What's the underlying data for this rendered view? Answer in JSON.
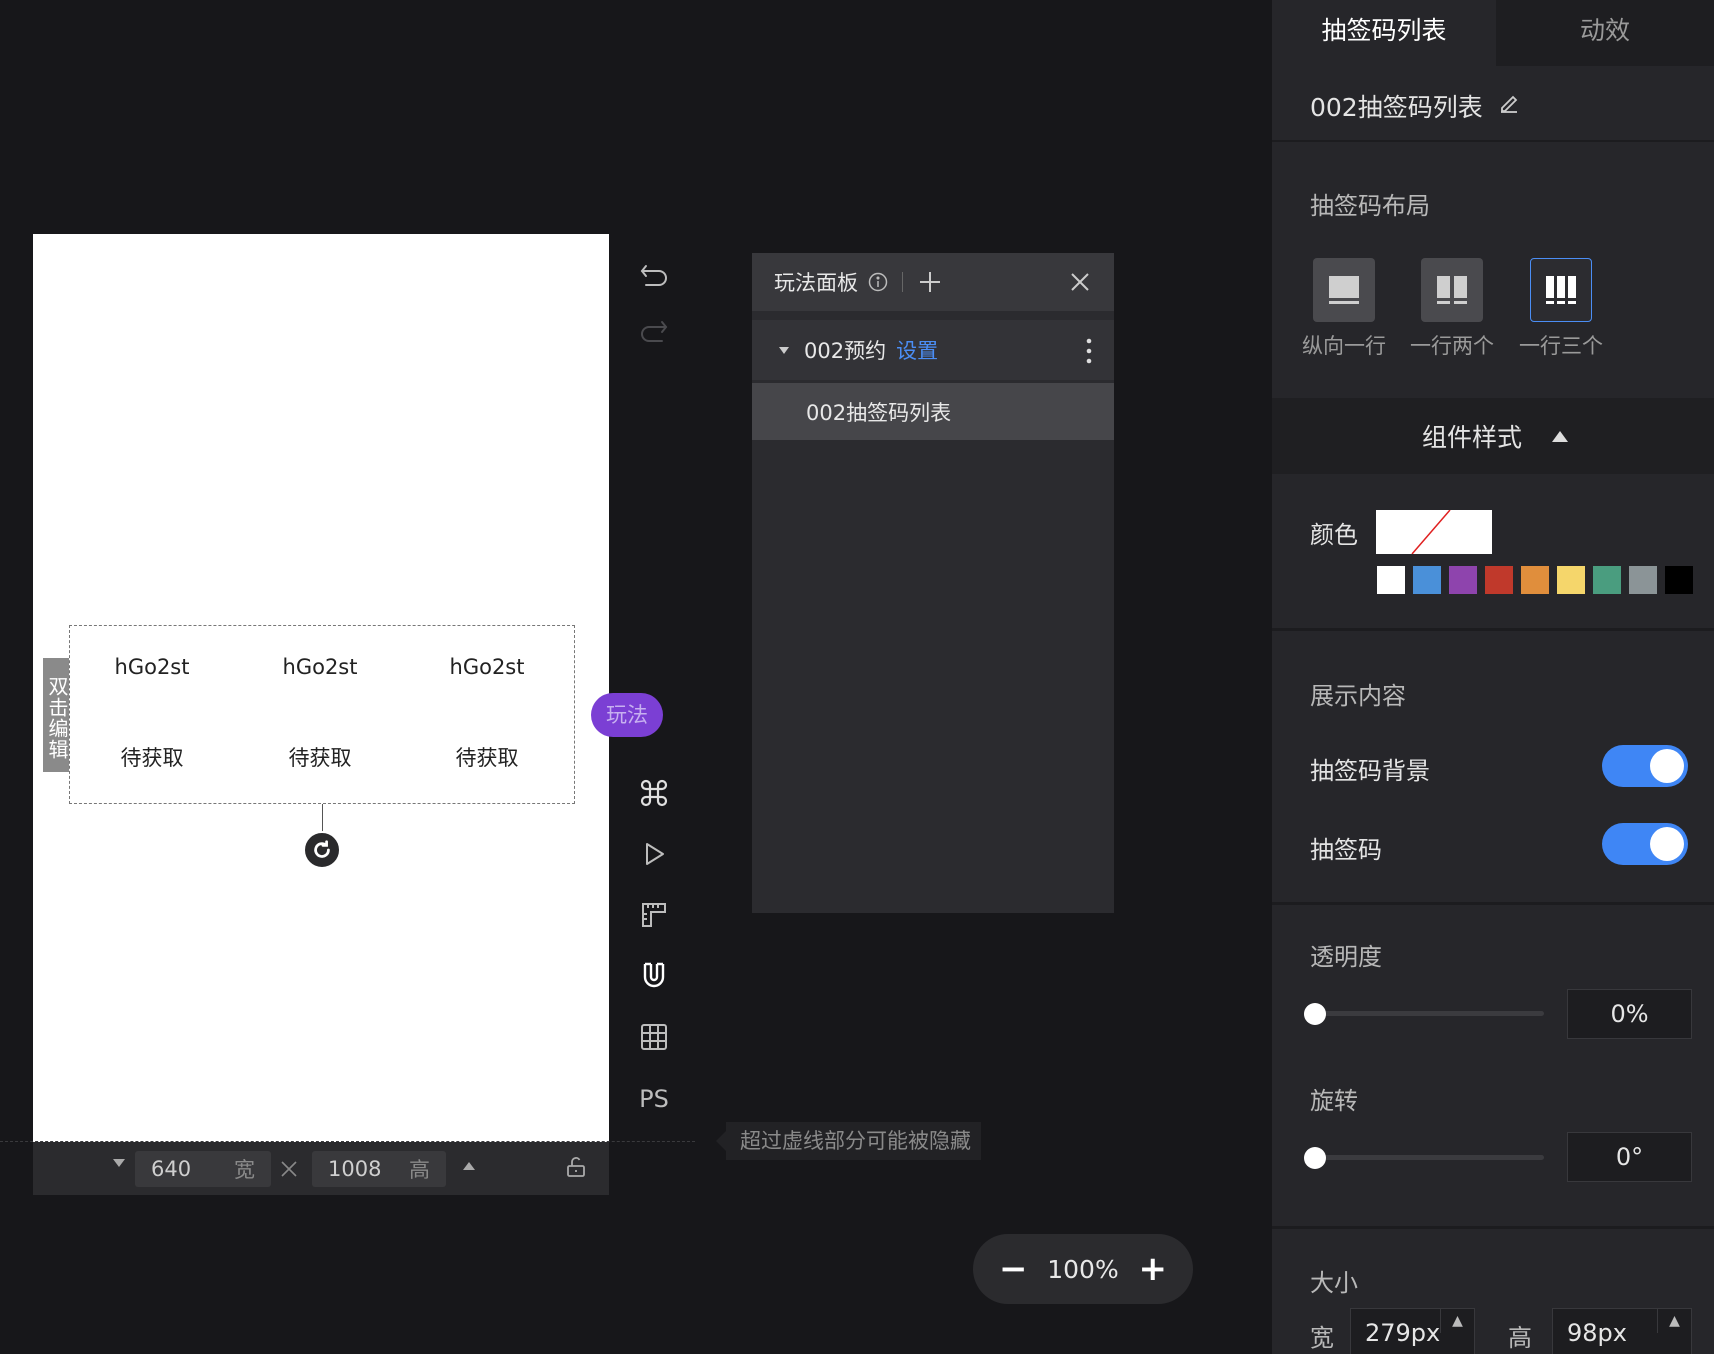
{
  "canvas": {
    "code_list": {
      "codes": [
        "hGo2st",
        "hGo2st",
        "hGo2st"
      ],
      "statuses": [
        "待获取",
        "待获取",
        "待获取"
      ]
    },
    "double_click_edit": "双击编辑",
    "play_chip": "玩法"
  },
  "bottom_bar": {
    "width": "640",
    "width_unit": "宽",
    "height": "1008",
    "height_unit": "高"
  },
  "toolbar": {
    "ps_label": "PS"
  },
  "play_panel": {
    "title": "玩法面板",
    "tree_item": "002预约",
    "tree_item_link": "设置",
    "child_item": "002抽签码列表"
  },
  "hint": "超过虚线部分可能被隐藏",
  "zoom": {
    "minus": "−",
    "level": "100%",
    "plus": "+"
  },
  "right_panel": {
    "tabs": [
      "抽签码列表",
      "动效"
    ],
    "component_name": "002抽签码列表",
    "layout_label": "抽签码布局",
    "layout_options": [
      "纵向一行",
      "一行两个",
      "一行三个"
    ],
    "style_header": "组件样式",
    "color_label": "颜色",
    "swatches": [
      "#ffffff",
      "#4a90d9",
      "#8e44ad",
      "#c0392b",
      "#e08e3c",
      "#f5d66b",
      "#4a9d7f",
      "#8b9497",
      "#000000"
    ],
    "display_content_label": "展示内容",
    "toggle_bg_label": "抽签码背景",
    "toggle_code_label": "抽签码",
    "opacity_label": "透明度",
    "opacity_value": "0%",
    "rotate_label": "旋转",
    "rotate_value": "0°",
    "size_label": "大小",
    "size_w_label": "宽",
    "size_w_value": "279px",
    "size_h_label": "高",
    "size_h_value": "98px"
  },
  "colors": {
    "accent": "#3f86f5",
    "play_purple": "#7b3fd4",
    "link_blue": "#4b8ef5"
  }
}
